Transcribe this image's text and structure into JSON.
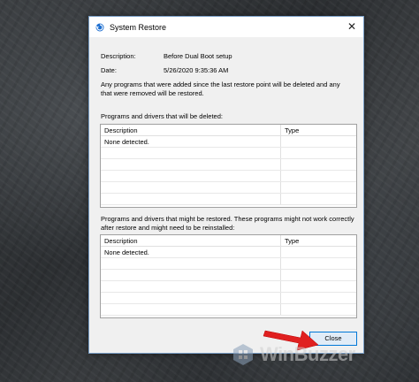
{
  "window": {
    "title": "System Restore"
  },
  "details": {
    "description_label": "Description:",
    "description_value": "Before Dual Boot setup",
    "date_label": "Date:",
    "date_value": "5/26/2020 9:35:36 AM"
  },
  "info_text": "Any programs that were added since the last restore point will be deleted and any that were removed will be restored.",
  "deleted_section": {
    "label": "Programs and drivers that will be deleted:",
    "columns": [
      "Description",
      "Type"
    ],
    "rows": [
      [
        "None detected.",
        ""
      ]
    ]
  },
  "restored_section": {
    "label": "Programs and drivers that might be restored. These programs might not work correctly after restore and might need to be reinstalled:",
    "columns": [
      "Description",
      "Type"
    ],
    "rows": [
      [
        "None detected.",
        ""
      ]
    ]
  },
  "buttons": {
    "close": "Close"
  },
  "watermark": {
    "text": "WinBuzzer"
  },
  "colors": {
    "accent": "#0078d7",
    "arrow": "#e02020"
  }
}
